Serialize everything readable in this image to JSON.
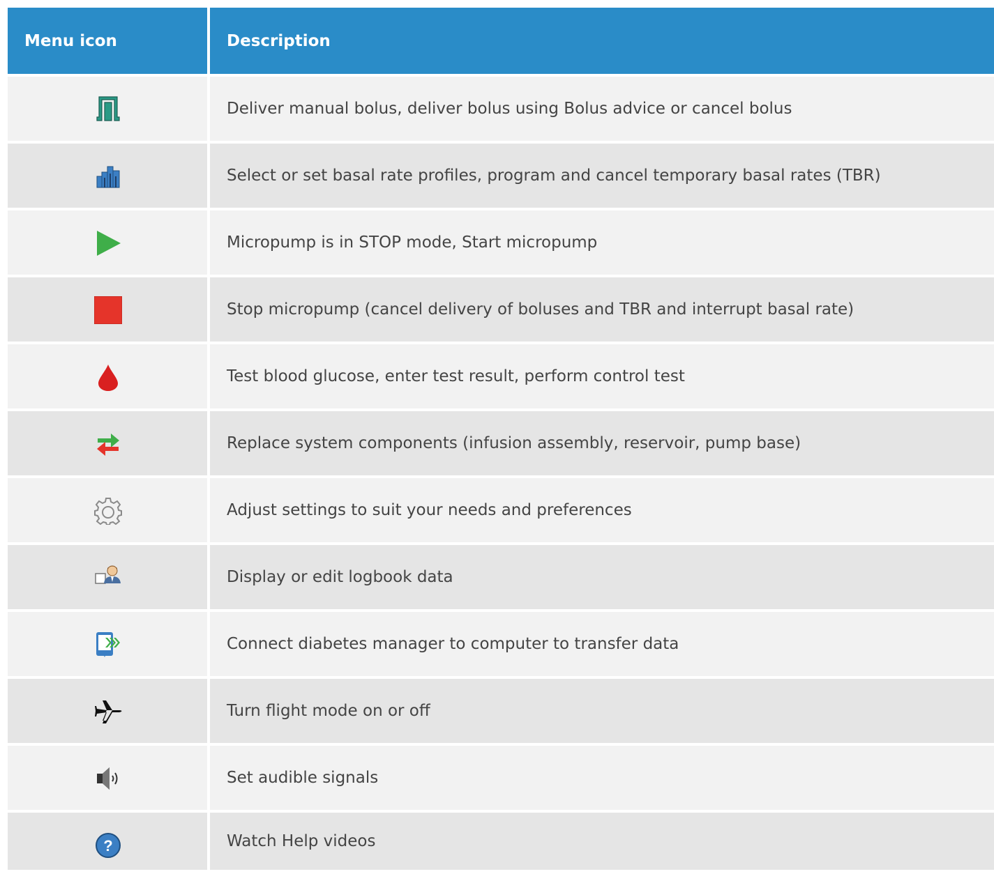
{
  "header": {
    "col_icon": "Menu icon",
    "col_desc": "Description"
  },
  "rows": [
    {
      "icon": "bolus-pulse-icon",
      "description": "Deliver manual bolus, deliver bolus using Bolus advice or cancel bolus"
    },
    {
      "icon": "basal-rate-bars-icon",
      "description": "Select or set basal rate profiles, program and cancel temporary basal rates (TBR)"
    },
    {
      "icon": "play-triangle-icon",
      "description": "Micropump is in STOP mode, Start micropump"
    },
    {
      "icon": "stop-square-icon",
      "description": "Stop micropump (cancel delivery of boluses and TBR and interrupt basal rate)"
    },
    {
      "icon": "blood-drop-icon",
      "description": "Test blood glucose, enter test result, perform control test"
    },
    {
      "icon": "swap-arrows-icon",
      "description": "Replace system components (infusion assembly, reservoir, pump base)"
    },
    {
      "icon": "gear-icon",
      "description": "Adjust settings to suit your needs and preferences"
    },
    {
      "icon": "logbook-person-icon",
      "description": "Display or edit logbook data"
    },
    {
      "icon": "device-transfer-icon",
      "description": "Connect diabetes manager to computer to transfer data"
    },
    {
      "icon": "airplane-icon",
      "description": "Turn flight mode on or off"
    },
    {
      "icon": "speaker-icon",
      "description": "Set audible signals"
    },
    {
      "icon": "help-question-icon",
      "description": "Watch Help videos"
    }
  ],
  "colors": {
    "header_bg": "#2a8cc8",
    "row_light": "#f2f2f2",
    "row_dark": "#e5e5e5",
    "teal": "#2a9a86",
    "blue": "#3b7fc4",
    "green": "#3fae49",
    "red": "#e5342a"
  }
}
